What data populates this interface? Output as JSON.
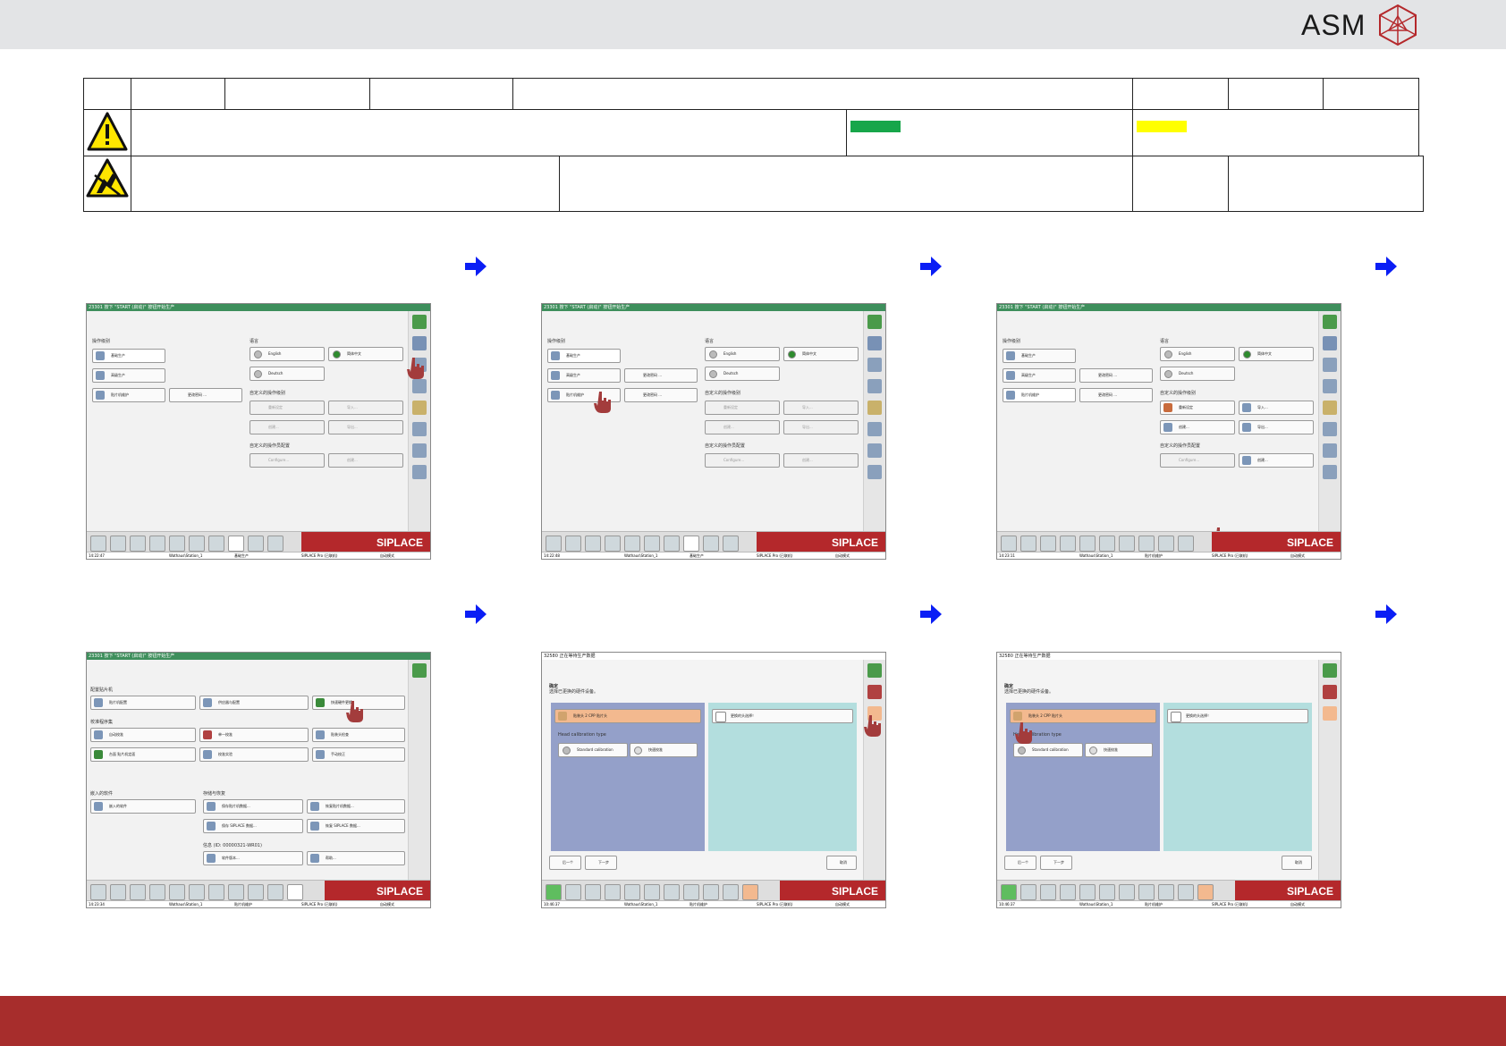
{
  "header": {
    "logo_text": "ASM"
  },
  "colors": {
    "top_bar": "#e3e4e6",
    "footer_bar": "#a72d2c",
    "green_swatch": "#17a64a",
    "yellow_swatch": "#ffff00",
    "arrow": "#0a1ef5",
    "siplace_red": "#b4282b"
  },
  "info_table": {
    "icons": [
      "warning-icon",
      "esd-icon"
    ]
  },
  "arrows": [
    "arrow-right-icon",
    "arrow-right-icon",
    "arrow-right-icon",
    "arrow-right-icon",
    "arrow-right-icon",
    "arrow-right-icon"
  ],
  "screens": {
    "brand": "SIPLACE",
    "menu": {
      "title": "23301 按下 \"START (启动)\" 按钮开始生产",
      "sec_level": "操作级别",
      "sec_lang": "语言",
      "sec_custom": "自定义的操作级别",
      "sec_config": "自定义的操作员配置",
      "basic_prod": "基础生产",
      "adv_prod": "高级生产",
      "maint": "贴片机维护",
      "change_pwd": "更改密码 ...",
      "english": "English",
      "chinese": "简体中文",
      "deutsch": "Deutsch",
      "reset": "重新设定",
      "import": "导入...",
      "create": "创建...",
      "export": "导出...",
      "configure": "Configure...",
      "create2": "创建...",
      "status_machine": "Wathaus\\Station_1",
      "status_role": "基础生产",
      "status_role_maint": "贴片机维护",
      "status_siplace": "SIPLACE Pro (已联机)",
      "status_mode": "自动模式",
      "time1": "14:22:47",
      "time2": "14:22:48",
      "time3": "14:23:11"
    },
    "maint": {
      "sec_config": "配置贴片机",
      "sec_calib": "校准程序集",
      "sec_embedded": "嵌入的软件",
      "sec_storage": "存储与恢复",
      "sec_info": "信息 (ID: 00000321-WR01)",
      "machine_config": "贴片机配置",
      "feeder_config": "供应器与配置",
      "quick_hw": "快速硬件更换",
      "auto_calib": "自动校准",
      "single_calib": "单一校准",
      "head_check": "贴装头检查",
      "pcb_calib": "台面 贴片机定面",
      "calib_test": "校准实验",
      "manual_calib": "手动校正",
      "embedded_sw": "嵌入的软件",
      "save_config": "保存贴片机数据...",
      "restore_config": "恢复贴片机数据...",
      "save_siplace": "保存 SIPLACE 数据...",
      "restore_siplace": "恢复 SIPLACE 数据...",
      "sw_version": "软件版本...",
      "help": "帮助...",
      "time": "14:23:34"
    },
    "calib": {
      "title": "32580 正在等待生产数据",
      "subtitle": "确定",
      "hint": "选择已更换的硬件设备。",
      "option1": "贴装头 2 CPP 贴片头",
      "option2": "更换的头选择！",
      "label": "Head calibration type",
      "standard": "Standard calibration",
      "quick": "快速校准",
      "prev": "后一个",
      "next": "下一步",
      "cancel": "取消",
      "time": "10:46:37"
    }
  }
}
